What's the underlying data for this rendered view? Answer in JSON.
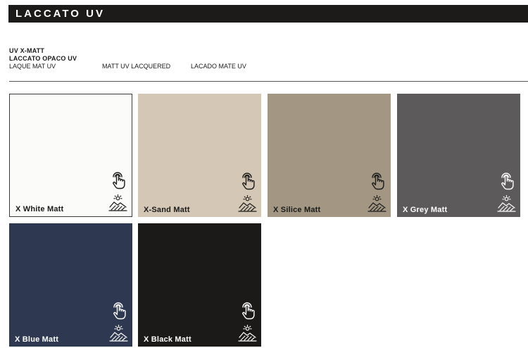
{
  "header": {
    "title": "LACCATO UV"
  },
  "meta": {
    "line1": "UV  X-MATT",
    "line2": "LACCATO OPACO UV",
    "labels": [
      "LAQUE MAT UV",
      "MATT UV LACQUERED",
      "LACADO MATE UV"
    ]
  },
  "swatches": [
    {
      "name": "X White Matt",
      "color": "#fbfbfa",
      "text_color": "#1a1a1a",
      "touch_icon": "touch-hand-icon",
      "uv_icon": "uv-sun-surface-icon"
    },
    {
      "name": "X-Sand Matt",
      "color": "#d4c7b5",
      "text_color": "#1a1a1a",
      "touch_icon": "touch-hand-icon",
      "uv_icon": "uv-sun-surface-icon"
    },
    {
      "name": "X Silice Matt",
      "color": "#a39784",
      "text_color": "#1a1a1a",
      "touch_icon": "touch-hand-icon",
      "uv_icon": "uv-sun-surface-icon"
    },
    {
      "name": "X Grey Matt",
      "color": "#5c5a5b",
      "text_color": "#ffffff",
      "touch_icon": "touch-hand-icon",
      "uv_icon": "uv-sun-surface-icon"
    },
    {
      "name": "X Blue Matt",
      "color": "#2e3851",
      "text_color": "#ffffff",
      "touch_icon": "touch-hand-icon",
      "uv_icon": "uv-sun-surface-icon"
    },
    {
      "name": "X Black Matt",
      "color": "#1b1a19",
      "text_color": "#ffffff",
      "touch_icon": "touch-hand-icon",
      "uv_icon": "uv-sun-surface-icon"
    }
  ]
}
